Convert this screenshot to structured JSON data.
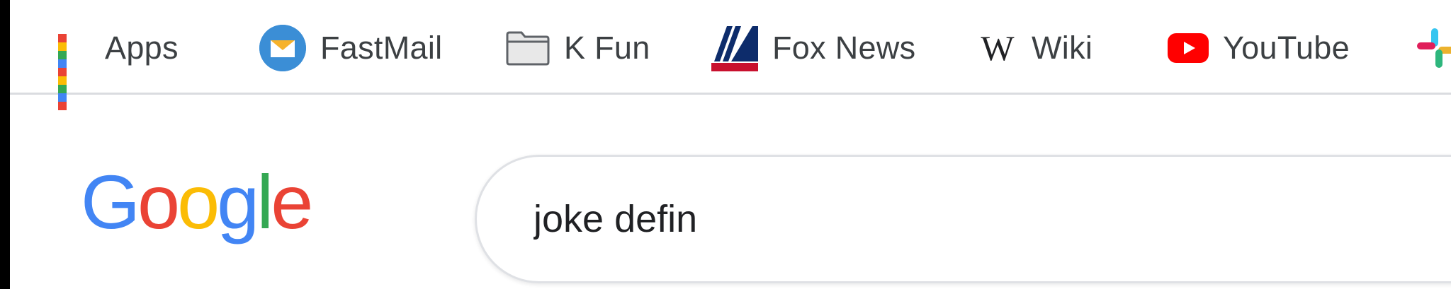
{
  "bookmarks": [
    {
      "label": "Apps",
      "icon": "apps-grid-icon"
    },
    {
      "label": "FastMail",
      "icon": "fastmail-icon"
    },
    {
      "label": "K Fun",
      "icon": "folder-icon"
    },
    {
      "label": "Fox News",
      "icon": "fox-news-icon"
    },
    {
      "label": "Wiki",
      "icon": "wikipedia-icon",
      "glyph": "W"
    },
    {
      "label": "YouTube",
      "icon": "youtube-icon"
    },
    {
      "label": "",
      "icon": "slack-icon"
    }
  ],
  "logo": {
    "letters": [
      "G",
      "o",
      "o",
      "g",
      "l",
      "e"
    ],
    "colors": [
      "#4285F4",
      "#EA4335",
      "#FBBC05",
      "#4285F4",
      "#34A853",
      "#EA4335"
    ]
  },
  "search": {
    "value": "joke defin"
  },
  "colors": {
    "apps_grid": [
      "#ea4335",
      "#fbbc05",
      "#34a853",
      "#4285f4",
      "#ea4335",
      "#fbbc05",
      "#34a853",
      "#4285f4",
      "#ea4335"
    ],
    "fastmail": "#3b8ed6",
    "youtube": "#ff0000"
  }
}
